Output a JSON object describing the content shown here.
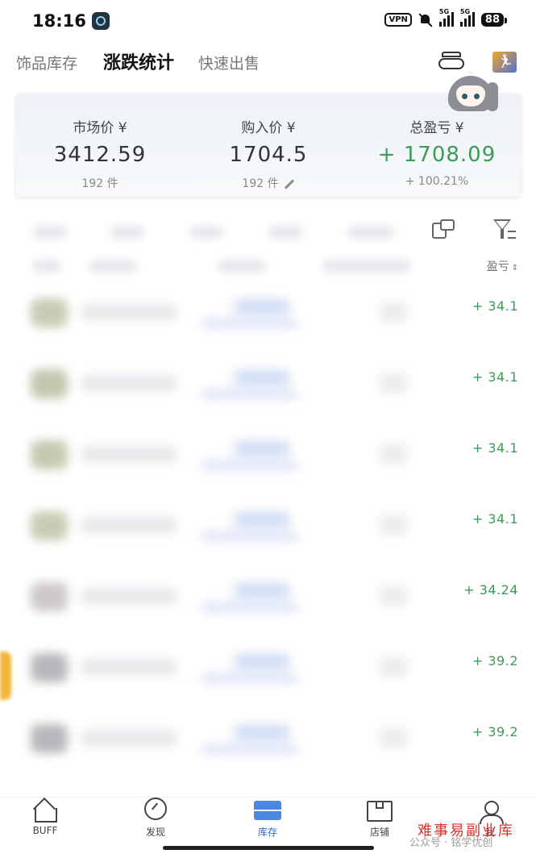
{
  "status_bar": {
    "time": "18:16",
    "vpn_label": "VPN",
    "signal_label_1": "5G",
    "signal_label_2": "5G",
    "battery": "88"
  },
  "top_tabs": [
    {
      "label": "饰品库存",
      "active": false
    },
    {
      "label": "涨跌统计",
      "active": true
    },
    {
      "label": "快速出售",
      "active": false
    }
  ],
  "summary": {
    "market_price": {
      "label": "市场价 ¥",
      "value": "3412.59",
      "sub": "192 件"
    },
    "purchase_price": {
      "label": "购入价 ¥",
      "value": "1704.5",
      "sub": "192 件"
    },
    "total_pl": {
      "label": "总盈亏 ¥",
      "value": "+ 1708.09",
      "sub": "+ 100.21%",
      "color": "#3e9a58"
    }
  },
  "list": {
    "sort_label": "盈亏",
    "sort_icon": "sort-arrows-icon",
    "rows": [
      {
        "pl": "+ 34.1",
        "thumb_color": "#c9ccb4"
      },
      {
        "pl": "+ 34.1",
        "thumb_color": "#c4c7ae"
      },
      {
        "pl": "+ 34.1",
        "thumb_color": "#c6c9b0"
      },
      {
        "pl": "+ 34.1",
        "thumb_color": "#c9ccb4"
      },
      {
        "pl": "+ 34.24",
        "thumb_color": "#cdc8cc"
      },
      {
        "pl": "+ 39.2",
        "thumb_color": "#b8b8bc"
      },
      {
        "pl": "+ 39.2",
        "thumb_color": "#b8b8bc"
      }
    ]
  },
  "bottom_nav": [
    {
      "label": "BUFF",
      "icon": "home-icon",
      "active": false
    },
    {
      "label": "发现",
      "icon": "discover-icon",
      "active": false
    },
    {
      "label": "库存",
      "icon": "inventory-icon",
      "active": true
    },
    {
      "label": "店铺",
      "icon": "shop-icon",
      "active": false
    },
    {
      "label": "我",
      "icon": "me-icon",
      "active": false
    }
  ],
  "watermark": {
    "line1": "难事易副业库",
    "line2": "公众号 · 铭学优创"
  },
  "colors": {
    "accent_green": "#3e9a58",
    "nav_active_blue": "#2c68c9"
  }
}
